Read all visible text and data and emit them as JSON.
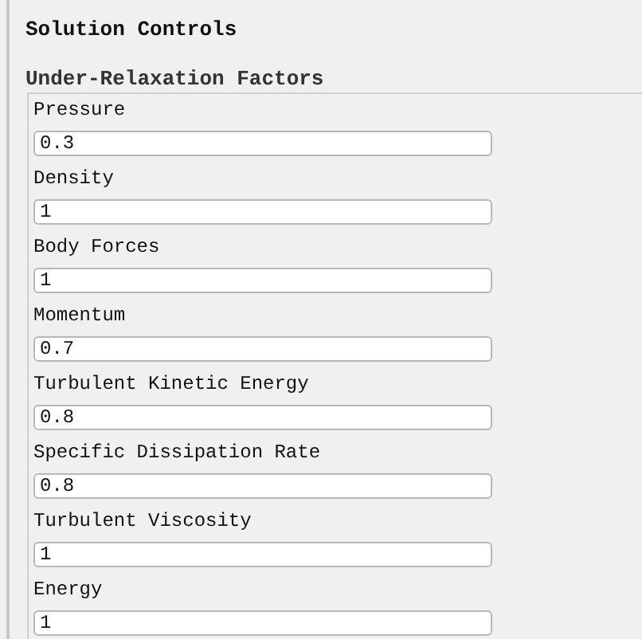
{
  "panel": {
    "title": "Solution Controls"
  },
  "group": {
    "title": "Under-Relaxation Factors",
    "fields": [
      {
        "label": "Pressure",
        "value": "0.3"
      },
      {
        "label": "Density",
        "value": "1"
      },
      {
        "label": "Body Forces",
        "value": "1"
      },
      {
        "label": "Momentum",
        "value": "0.7"
      },
      {
        "label": "Turbulent Kinetic Energy",
        "value": "0.8"
      },
      {
        "label": "Specific Dissipation Rate",
        "value": "0.8"
      },
      {
        "label": "Turbulent Viscosity",
        "value": "1"
      },
      {
        "label": "Energy",
        "value": "1"
      }
    ]
  }
}
